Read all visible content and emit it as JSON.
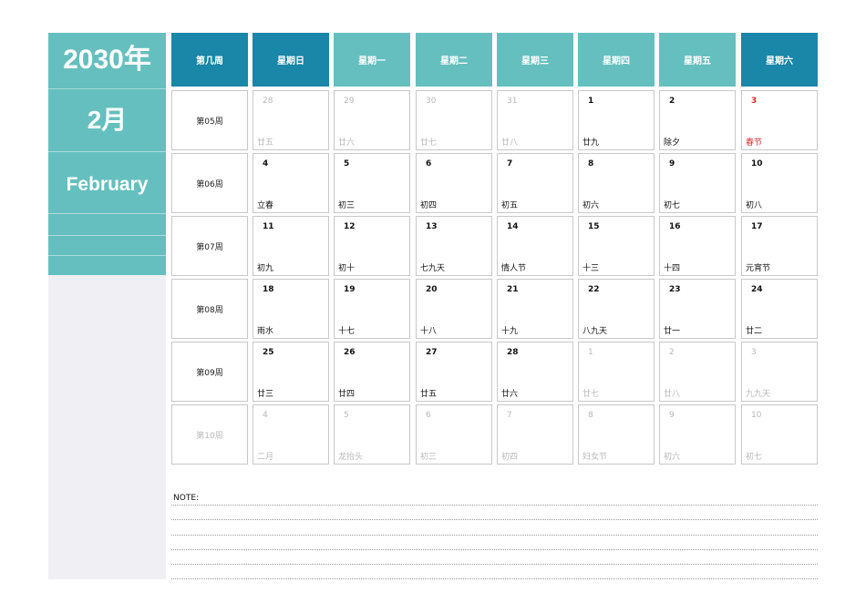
{
  "sidebar": {
    "year": "2030年",
    "month": "2月",
    "month_en": "February"
  },
  "header": {
    "week_col": "第几周",
    "days": [
      "星期日",
      "星期一",
      "星期二",
      "星期三",
      "星期四",
      "星期五",
      "星期六"
    ]
  },
  "weeks": [
    {
      "label": "第05周",
      "muted": false,
      "days": [
        {
          "d": "28",
          "l": "廿五",
          "other": true
        },
        {
          "d": "29",
          "l": "廿六",
          "other": true
        },
        {
          "d": "30",
          "l": "廿七",
          "other": true
        },
        {
          "d": "31",
          "l": "廿八",
          "other": true
        },
        {
          "d": "1",
          "l": "廿九"
        },
        {
          "d": "2",
          "l": "除夕"
        },
        {
          "d": "3",
          "l": "春节",
          "holiday": true
        }
      ]
    },
    {
      "label": "第06周",
      "muted": false,
      "days": [
        {
          "d": "4",
          "l": "立春"
        },
        {
          "d": "5",
          "l": "初三"
        },
        {
          "d": "6",
          "l": "初四"
        },
        {
          "d": "7",
          "l": "初五"
        },
        {
          "d": "8",
          "l": "初六"
        },
        {
          "d": "9",
          "l": "初七"
        },
        {
          "d": "10",
          "l": "初八"
        }
      ]
    },
    {
      "label": "第07周",
      "muted": false,
      "days": [
        {
          "d": "11",
          "l": "初九"
        },
        {
          "d": "12",
          "l": "初十"
        },
        {
          "d": "13",
          "l": "七九天"
        },
        {
          "d": "14",
          "l": "情人节"
        },
        {
          "d": "15",
          "l": "十三"
        },
        {
          "d": "16",
          "l": "十四"
        },
        {
          "d": "17",
          "l": "元宵节"
        }
      ]
    },
    {
      "label": "第08周",
      "muted": false,
      "days": [
        {
          "d": "18",
          "l": "雨水"
        },
        {
          "d": "19",
          "l": "十七"
        },
        {
          "d": "20",
          "l": "十八"
        },
        {
          "d": "21",
          "l": "十九"
        },
        {
          "d": "22",
          "l": "八九天"
        },
        {
          "d": "23",
          "l": "廿一"
        },
        {
          "d": "24",
          "l": "廿二"
        }
      ]
    },
    {
      "label": "第09周",
      "muted": false,
      "days": [
        {
          "d": "25",
          "l": "廿三"
        },
        {
          "d": "26",
          "l": "廿四"
        },
        {
          "d": "27",
          "l": "廿五"
        },
        {
          "d": "28",
          "l": "廿六"
        },
        {
          "d": "1",
          "l": "廿七",
          "other": true
        },
        {
          "d": "2",
          "l": "廿八",
          "other": true
        },
        {
          "d": "3",
          "l": "九九天",
          "other": true
        }
      ]
    },
    {
      "label": "第10周",
      "muted": true,
      "days": [
        {
          "d": "4",
          "l": "二月",
          "other": true
        },
        {
          "d": "5",
          "l": "龙抬头",
          "other": true
        },
        {
          "d": "6",
          "l": "初三",
          "other": true
        },
        {
          "d": "7",
          "l": "初四",
          "other": true
        },
        {
          "d": "8",
          "l": "妇女节",
          "other": true
        },
        {
          "d": "9",
          "l": "初六",
          "other": true
        },
        {
          "d": "10",
          "l": "初七",
          "other": true
        }
      ]
    }
  ],
  "notes": {
    "label": "NOTE:"
  },
  "colors": {
    "teal_light": "#65bfbf",
    "teal_dark": "#1a86a8",
    "sidebar_bg": "#efeff4",
    "holiday_red": "#e0282d"
  }
}
